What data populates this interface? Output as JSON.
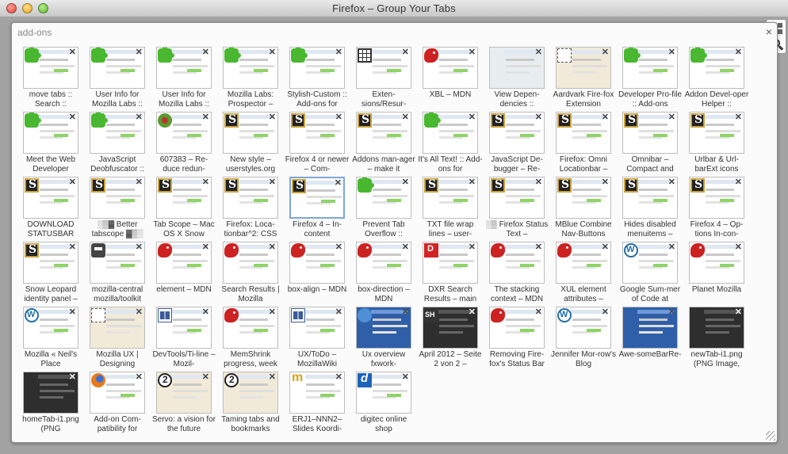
{
  "window": {
    "title": "Firefox – Group Your Tabs"
  },
  "group": {
    "title": "add-ons"
  },
  "side_icons": [
    "grid-icon",
    "search-icon",
    "gmail-icon",
    "puzzle-icon"
  ],
  "tabs": [
    {
      "label": "move tabs :: Search ::",
      "icon": "puzzle",
      "style": ""
    },
    {
      "label": "User Info for Mozilla Labs ::",
      "icon": "puzzle",
      "style": ""
    },
    {
      "label": "User Info for Mozilla Labs ::",
      "icon": "puzzle",
      "style": ""
    },
    {
      "label": "Mozilla Labs: Prospector –",
      "icon": "puzzle",
      "style": ""
    },
    {
      "label": "Stylish-Custom :: Add-ons for",
      "icon": "puzzle",
      "style": ""
    },
    {
      "label": "Exten-sions/Resur-",
      "icon": "grid",
      "style": ""
    },
    {
      "label": "XBL – MDN",
      "icon": "mdn",
      "style": ""
    },
    {
      "label": "View Depen-dencies ::",
      "icon": "none",
      "style": "teal"
    },
    {
      "label": "Aardvark Fire-fox Extension",
      "icon": "dashed",
      "style": "beige"
    },
    {
      "label": "Developer Pro-file :: Add-ons",
      "icon": "puzzle",
      "style": ""
    },
    {
      "label": "Addon Devel-oper Helper ::",
      "icon": "puzzle",
      "style": ""
    },
    {
      "label": "Meet the Web Developer",
      "icon": "puzzle",
      "style": ""
    },
    {
      "label": "JavaScript Deobfuscator ::",
      "icon": "puzzle",
      "style": ""
    },
    {
      "label": "607383 – Re-duce redun-",
      "icon": "bug",
      "style": ""
    },
    {
      "label": "New style – userstyles.org",
      "icon": "s",
      "style": ""
    },
    {
      "label": "Firefox 4 or newer – Com-",
      "icon": "s",
      "style": ""
    },
    {
      "label": "Addons man-ager – make it",
      "icon": "s",
      "style": ""
    },
    {
      "label": "It's All Text! :: Add-ons for",
      "icon": "puzzle",
      "style": ""
    },
    {
      "label": "JavaScript De-bugger – Re-",
      "icon": "s",
      "style": ""
    },
    {
      "label": "Firefox: Omni Locationbar –",
      "icon": "s",
      "style": ""
    },
    {
      "label": "Omnibar – Compact and",
      "icon": "s",
      "style": ""
    },
    {
      "label": "Urlbar & Url-barExt icons",
      "icon": "s",
      "style": ""
    },
    {
      "label": "DOWNLOAD STATUSBAR",
      "icon": "s",
      "style": ""
    },
    {
      "label": "░▒▓ Better tabscope ▓▒░",
      "icon": "s",
      "style": ""
    },
    {
      "label": "Tab Scope – Mac OS X Snow",
      "icon": "s",
      "style": ""
    },
    {
      "label": "Firefox: Loca-tionbar^2: CSS",
      "icon": "s",
      "style": ""
    },
    {
      "label": "Firefox 4 – In-content",
      "icon": "s",
      "style": "",
      "selected": true
    },
    {
      "label": "Prevent Tab Overflow ::",
      "icon": "puzzle",
      "style": ""
    },
    {
      "label": "TXT file wrap lines – user-",
      "icon": "s",
      "style": ""
    },
    {
      "label": "░▒ Firefox Status Text –",
      "icon": "s",
      "style": ""
    },
    {
      "label": "MBlue Combine Nav-Buttons",
      "icon": "s",
      "style": ""
    },
    {
      "label": "Hides disabled menuitems –",
      "icon": "s",
      "style": ""
    },
    {
      "label": "Firefox 4 – Op-tions In-con-",
      "icon": "s",
      "style": ""
    },
    {
      "label": "Snow Leopard identity panel –",
      "icon": "s",
      "style": ""
    },
    {
      "label": "mozilla-central mozilla/toolkit",
      "icon": "robot",
      "style": ""
    },
    {
      "label": "element – MDN",
      "icon": "mdn",
      "style": ""
    },
    {
      "label": "Search Results | Mozilla",
      "icon": "mdn",
      "style": ""
    },
    {
      "label": "box-align – MDN",
      "icon": "mdn",
      "style": ""
    },
    {
      "label": "box-direction – MDN",
      "icon": "mdn",
      "style": ""
    },
    {
      "label": "DXR Search Results – main",
      "icon": "dred",
      "style": ""
    },
    {
      "label": "The stacking context – MDN",
      "icon": "mdn",
      "style": ""
    },
    {
      "label": "XUL element attributes –",
      "icon": "mdn",
      "style": ""
    },
    {
      "label": "Google Sum-mer of Code at",
      "icon": "wp",
      "style": ""
    },
    {
      "label": "Planet Mozilla",
      "icon": "mdn",
      "style": ""
    },
    {
      "label": "Mozilla « Neil's Place",
      "icon": "wp",
      "style": ""
    },
    {
      "label": "Mozilla UX | Designing",
      "icon": "dashed",
      "style": "beige"
    },
    {
      "label": "DevTools/Ti-line – Mozil-",
      "icon": "book",
      "style": ""
    },
    {
      "label": "MemShrink progress, week",
      "icon": "mdn",
      "style": ""
    },
    {
      "label": "UX/ToDo – MozillaWiki",
      "icon": "book",
      "style": ""
    },
    {
      "label": "Ux overview fxwork-",
      "icon": "globe",
      "style": "blue"
    },
    {
      "label": "April 2012 – Seite 2 von 2 –",
      "icon": "sh",
      "style": "dark"
    },
    {
      "label": "Removing Fire-fox's Status Bar",
      "icon": "mdn",
      "style": ""
    },
    {
      "label": "Jennifer Mor-row's Blog",
      "icon": "wp",
      "style": ""
    },
    {
      "label": "Awe-someBarRe-",
      "icon": "none",
      "style": "blue"
    },
    {
      "label": "newTab-i1.png (PNG Image,",
      "icon": "none",
      "style": "dark"
    },
    {
      "label": "homeTab-i1.png (PNG",
      "icon": "none",
      "style": "dark"
    },
    {
      "label": "Add-on Com-patibility for",
      "icon": "ff",
      "style": ""
    },
    {
      "label": "Servo: a vision for the future",
      "icon": "two",
      "style": "beige"
    },
    {
      "label": "Taming tabs and bookmarks",
      "icon": "two",
      "style": "beige"
    },
    {
      "label": "ERJ1–NNN2–Slides Koordi-",
      "icon": "m",
      "style": ""
    },
    {
      "label": "digitec online shop",
      "icon": "d",
      "style": ""
    }
  ]
}
